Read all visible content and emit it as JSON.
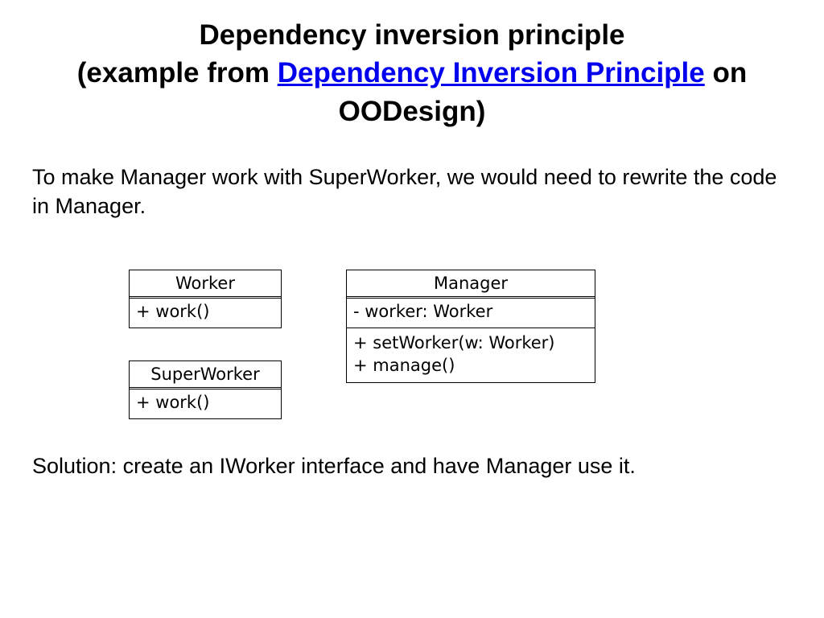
{
  "title": {
    "line1": "Dependency inversion principle",
    "prefix": "(example from ",
    "link_text": "Dependency Inversion Principle",
    "suffix": " on OODesign)"
  },
  "paragraph1": "To make Manager work with SuperWorker, we would need to rewrite the code in Manager.",
  "diagram": {
    "worker": {
      "name": "Worker",
      "methods": "+ work()"
    },
    "superworker": {
      "name": "SuperWorker",
      "methods": "+ work()"
    },
    "manager": {
      "name": "Manager",
      "attributes": "- worker: Worker",
      "methods": "+ setWorker(w: Worker)\n+ manage()"
    }
  },
  "paragraph2": "Solution: create an IWorker interface and have Manager use it."
}
